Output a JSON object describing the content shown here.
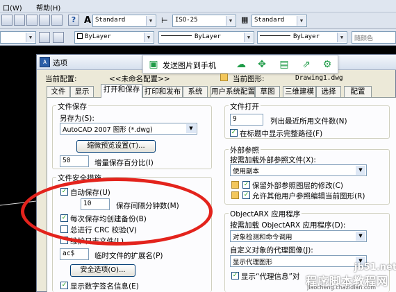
{
  "menubar": {
    "left": "口(W)",
    "help": "帮助(H)"
  },
  "toolbar": {
    "text_style": "Standard",
    "dim_style": "ISO-25",
    "table_style": "Standard",
    "layer_color": "ByLayer",
    "linetype": "ByLayer",
    "lineweight": "ByLayer",
    "plot_style": "随颜色"
  },
  "dialog": {
    "title": "选项",
    "send_label": "发送图片到手机",
    "current_profile_label": "当前配置:",
    "current_profile_value": "<<未命名配置>>",
    "current_drawing_label": "当前图形:",
    "current_drawing_value": "Drawing1.dwg",
    "tabs": [
      {
        "label": "文件",
        "active": false
      },
      {
        "label": "显示",
        "active": false
      },
      {
        "label": "打开和保存",
        "active": true
      },
      {
        "label": "打印和发布",
        "active": false
      },
      {
        "label": "系统",
        "active": false
      },
      {
        "label": "用户系统配置",
        "active": false
      },
      {
        "label": "草图",
        "active": false
      },
      {
        "label": "三维建模",
        "active": false
      },
      {
        "label": "选择",
        "active": false
      },
      {
        "label": "配置",
        "active": false
      }
    ],
    "file_save": {
      "title": "文件保存",
      "save_as_label": "另存为(S):",
      "save_as_value": "AutoCAD 2007 图形 (*.dwg)",
      "thumbnail_button": "缩微预览设置(T)...",
      "incremental_value": "50",
      "incremental_label": "增量保存百分比(I)"
    },
    "file_safety": {
      "title": "文件安全措施",
      "autosave_label": "自动保存(U)",
      "autosave_checked": true,
      "minutes_value": "10",
      "minutes_label": "保存间隔分钟数(M)",
      "backup_label": "每次保存均创建备份(B)",
      "backup_checked": true,
      "crc_label": "总进行 CRC 校验(V)",
      "crc_checked": false,
      "log_label": "维护日志文件(L)",
      "log_checked": false,
      "temp_ext_value": "ac$",
      "temp_ext_label": "临时文件的扩展名(P)",
      "security_button": "安全选项(O)...",
      "digital_sig_label": "显示数字签名信息(E)",
      "digital_sig_checked": true
    },
    "file_open": {
      "title": "文件打开",
      "recent_value": "9",
      "recent_label": "列出最近所用文件数(N)",
      "full_path_label": "在标题中显示完整路径(F)",
      "full_path_checked": true
    },
    "xref": {
      "title": "外部参照",
      "demand_load_label": "按需加载外部参照文件(X):",
      "demand_load_value": "使用副本",
      "retain_layers_label": "保留外部参照图层的修改(C)",
      "retain_layers_checked": true,
      "allow_edit_label": "允许其他用户参照编辑当前图形(R)",
      "allow_edit_checked": true
    },
    "objectarx": {
      "title": "ObjectARX 应用程序",
      "demand_load_label": "按需加载 ObjectARX 应用程序(D):",
      "demand_load_value": "对象检测和命令调用",
      "proxy_label": "自定义对象的代理图像(J):",
      "proxy_value": "显示代理图形",
      "proxy_info_label": "显示“代理信息”对",
      "proxy_info_checked": true
    }
  },
  "watermark": {
    "site": "jb51.net",
    "line2": "程序脚本教程网",
    "url": "jiaocheng.chazidian.com"
  },
  "colors": {
    "highlight_circle": "#e3231c",
    "floatbar_icon": "#1e9b47"
  }
}
